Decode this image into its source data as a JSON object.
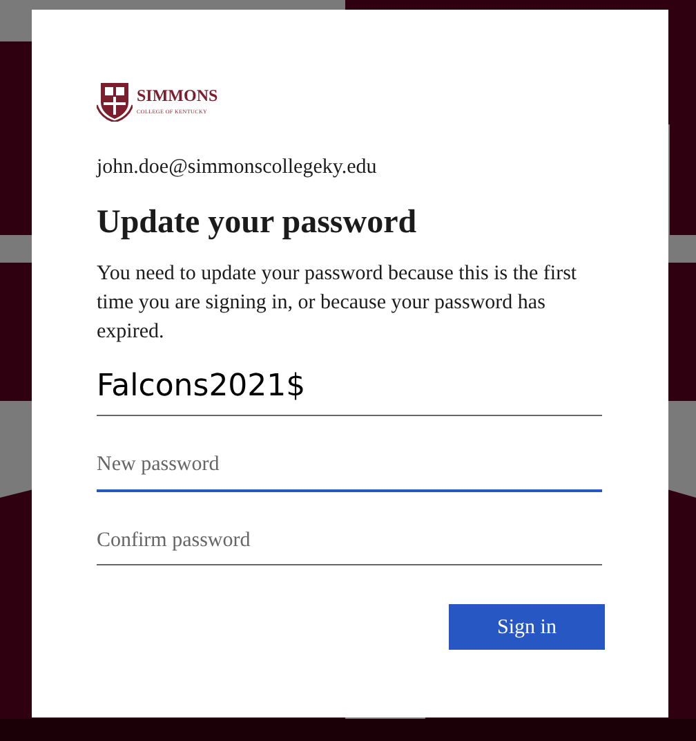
{
  "logo": {
    "name": "SIMMONS",
    "subtitle": "COLLEGE OF KENTUCKY"
  },
  "account": "john.doe@simmonscollegeky.edu",
  "title": "Update your password",
  "message": "You need to update your password because this is the first time you are signing in, or because your password has expired.",
  "fields": [
    {
      "kind": "value",
      "value": "Falcons2021$",
      "focused": false
    },
    {
      "kind": "placeholder",
      "placeholder": "New password",
      "focused": true
    },
    {
      "kind": "placeholder",
      "placeholder": "Confirm password",
      "focused": false
    }
  ],
  "button": "Sign in"
}
